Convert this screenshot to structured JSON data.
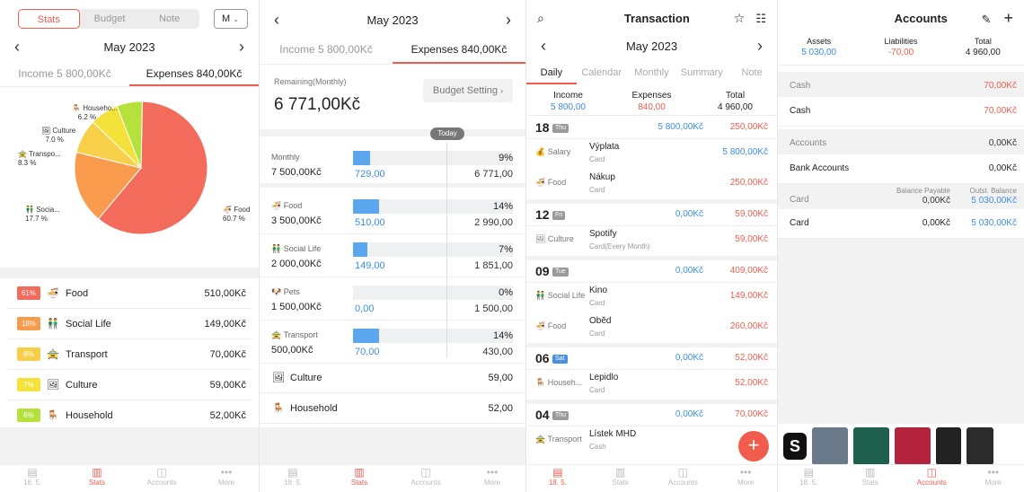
{
  "s1": {
    "seg": [
      "Stats",
      "Budget",
      "Note"
    ],
    "period_select": "M",
    "month": "May 2023",
    "tab_income": "Income 5 800,00Kč",
    "tab_expenses": "Expenses 840,00Kč",
    "pie": {
      "household": {
        "name": "Househo...",
        "pct": "6.2 %"
      },
      "culture": {
        "name": "Culture",
        "pct": "7.0 %"
      },
      "transport": {
        "name": "Transpo...",
        "pct": "8.3 %"
      },
      "social": {
        "name": "Socia...",
        "pct": "17.7 %"
      },
      "food": {
        "name": "Food",
        "pct": "60.7 %"
      }
    },
    "list": [
      {
        "pct": "61%",
        "name": "Food",
        "amt": "510,00Kč",
        "color": "#f26b5b",
        "icon": "🍜"
      },
      {
        "pct": "18%",
        "name": "Social Life",
        "amt": "149,00Kč",
        "color": "#f89b4d",
        "icon": "👬"
      },
      {
        "pct": "8%",
        "name": "Transport",
        "amt": "70,00Kč",
        "color": "#f7cf48",
        "icon": "🚖"
      },
      {
        "pct": "7%",
        "name": "Culture",
        "amt": "59,00Kč",
        "color": "#f3e23a",
        "icon": "🖼"
      },
      {
        "pct": "6%",
        "name": "Household",
        "amt": "52,00Kč",
        "color": "#b6e03c",
        "icon": "🪑"
      }
    ],
    "tabbar": [
      {
        "icon": "▤",
        "label": "18. 5."
      },
      {
        "icon": "▥",
        "label": "Stats"
      },
      {
        "icon": "◫",
        "label": "Accounts"
      },
      {
        "icon": "•••",
        "label": "More"
      }
    ]
  },
  "chart_data": {
    "type": "pie",
    "categories": [
      "Food",
      "Social Life",
      "Transport",
      "Culture",
      "Household"
    ],
    "values": [
      60.7,
      17.7,
      8.3,
      7.0,
      6.2
    ],
    "colors": [
      "#f26b5b",
      "#f89b4d",
      "#f7cf48",
      "#f3e23a",
      "#b6e03c"
    ]
  },
  "s2": {
    "month": "May 2023",
    "tab_income": "Income 5 800,00Kč",
    "tab_expenses": "Expenses 840,00Kč",
    "remaining_label": "Remaining(Monthly)",
    "remaining_value": "6 771,00Kč",
    "budget_setting": "Budget Setting",
    "today": "Today",
    "items": [
      {
        "name": "Monthly",
        "amt": "7 500,00Kč",
        "pct": "9%",
        "spent": "729,00",
        "left": "6 771,00",
        "fill": 0.09,
        "icon": ""
      },
      {
        "name": "Food",
        "amt": "3 500,00Kč",
        "pct": "14%",
        "spent": "510,00",
        "left": "2 990,00",
        "fill": 0.14,
        "icon": "🍜"
      },
      {
        "name": "Social Life",
        "amt": "2 000,00Kč",
        "pct": "7%",
        "spent": "149,00",
        "left": "1 851,00",
        "fill": 0.07,
        "icon": "👬"
      },
      {
        "name": "Pets",
        "amt": "1 500,00Kč",
        "pct": "0%",
        "spent": "0,00",
        "left": "1 500,00",
        "fill": 0.0,
        "icon": "🐶"
      },
      {
        "name": "Transport",
        "amt": "500,00Kč",
        "pct": "14%",
        "spent": "70,00",
        "left": "430,00",
        "fill": 0.14,
        "icon": "🚖"
      }
    ],
    "plain": [
      {
        "name": "Culture",
        "amt": "59,00",
        "icon": "🖼"
      },
      {
        "name": "Household",
        "amt": "52,00",
        "icon": "🪑"
      }
    ]
  },
  "s3": {
    "title": "Transaction",
    "month": "May 2023",
    "tabs": [
      "Daily",
      "Calendar",
      "Monthly",
      "Summary",
      "Note"
    ],
    "income_label": "Income",
    "income": "5 800,00",
    "expenses_label": "Expenses",
    "expenses": "840,00",
    "total_label": "Total",
    "total": "4 960,00",
    "days": [
      {
        "num": "18",
        "dow": "Thu",
        "inc": "5 800,00Kč",
        "exp": "250,00Kč",
        "badge": "#9a9a9a"
      },
      {
        "num": "12",
        "dow": "Fri",
        "inc": "0,00Kč",
        "exp": "59,00Kč",
        "badge": "#9a9a9a"
      },
      {
        "num": "09",
        "dow": "Tue",
        "inc": "0,00Kč",
        "exp": "409,00Kč",
        "badge": "#9a9a9a"
      },
      {
        "num": "06",
        "dow": "Sat",
        "inc": "0,00Kč",
        "exp": "52,00Kč",
        "badge": "#4a90e2"
      },
      {
        "num": "04",
        "dow": "Thu",
        "inc": "0,00Kč",
        "exp": "70,00Kč",
        "badge": "#9a9a9a"
      }
    ],
    "txns": [
      {
        "cat": "💰 Salary",
        "name": "Výplata",
        "sub": "Card",
        "amt": "5 800,00Kč",
        "type": "inc"
      },
      {
        "cat": "🍜 Food",
        "name": "Nákup",
        "sub": "Card",
        "amt": "250,00Kč",
        "type": "exp"
      },
      {
        "cat": "🖼 Culture",
        "name": "Spotify",
        "sub": "Card(Every Month)",
        "amt": "59,00Kč",
        "type": "exp"
      },
      {
        "cat": "👬 Social Life",
        "name": "Kino",
        "sub": "Card",
        "amt": "149,00Kč",
        "type": "exp"
      },
      {
        "cat": "🍜 Food",
        "name": "Oběd",
        "sub": "Card",
        "amt": "260,00Kč",
        "type": "exp"
      },
      {
        "cat": "🪑 Househ...",
        "name": "Lepidlo",
        "sub": "Card",
        "amt": "52,00Kč",
        "type": "exp"
      },
      {
        "cat": "🚖 Transport",
        "name": "Lístek MHD",
        "sub": "Cash",
        "amt": "",
        "type": "exp"
      }
    ],
    "tabbar": [
      {
        "icon": "▤",
        "label": "18. 5."
      },
      {
        "icon": "▥",
        "label": "Stats"
      },
      {
        "icon": "◫",
        "label": "Accounts"
      },
      {
        "icon": "•••",
        "label": "More"
      }
    ]
  },
  "s4": {
    "title": "Accounts",
    "assets_label": "Assets",
    "assets": "5 030,00",
    "liab_label": "Liabilities",
    "liab": "-70,00",
    "total_label": "Total",
    "total": "4 960,00",
    "g_cash": "Cash",
    "g_cash_amt": "70,00Kč",
    "r_cash": "Cash",
    "r_cash_amt": "70,00Kč",
    "g_acc": "Accounts",
    "g_acc_amt": "0,00Kč",
    "r_bank": "Bank Accounts",
    "r_bank_amt": "0,00Kč",
    "g_card": "Card",
    "g_card_bp": "Balance Payable",
    "g_card_bp_v": "0,00Kč",
    "g_card_ob": "Outst. Balance",
    "g_card_ob_v": "5 030,00Kč",
    "r_card": "Card",
    "r_card_bp": "0,00Kč",
    "r_card_ob": "5 030,00Kč",
    "tabbar": [
      {
        "icon": "▤",
        "label": "18. 5."
      },
      {
        "icon": "▥",
        "label": "Stats"
      },
      {
        "icon": "◫",
        "label": "Accounts"
      },
      {
        "icon": "•••",
        "label": "More"
      }
    ]
  }
}
